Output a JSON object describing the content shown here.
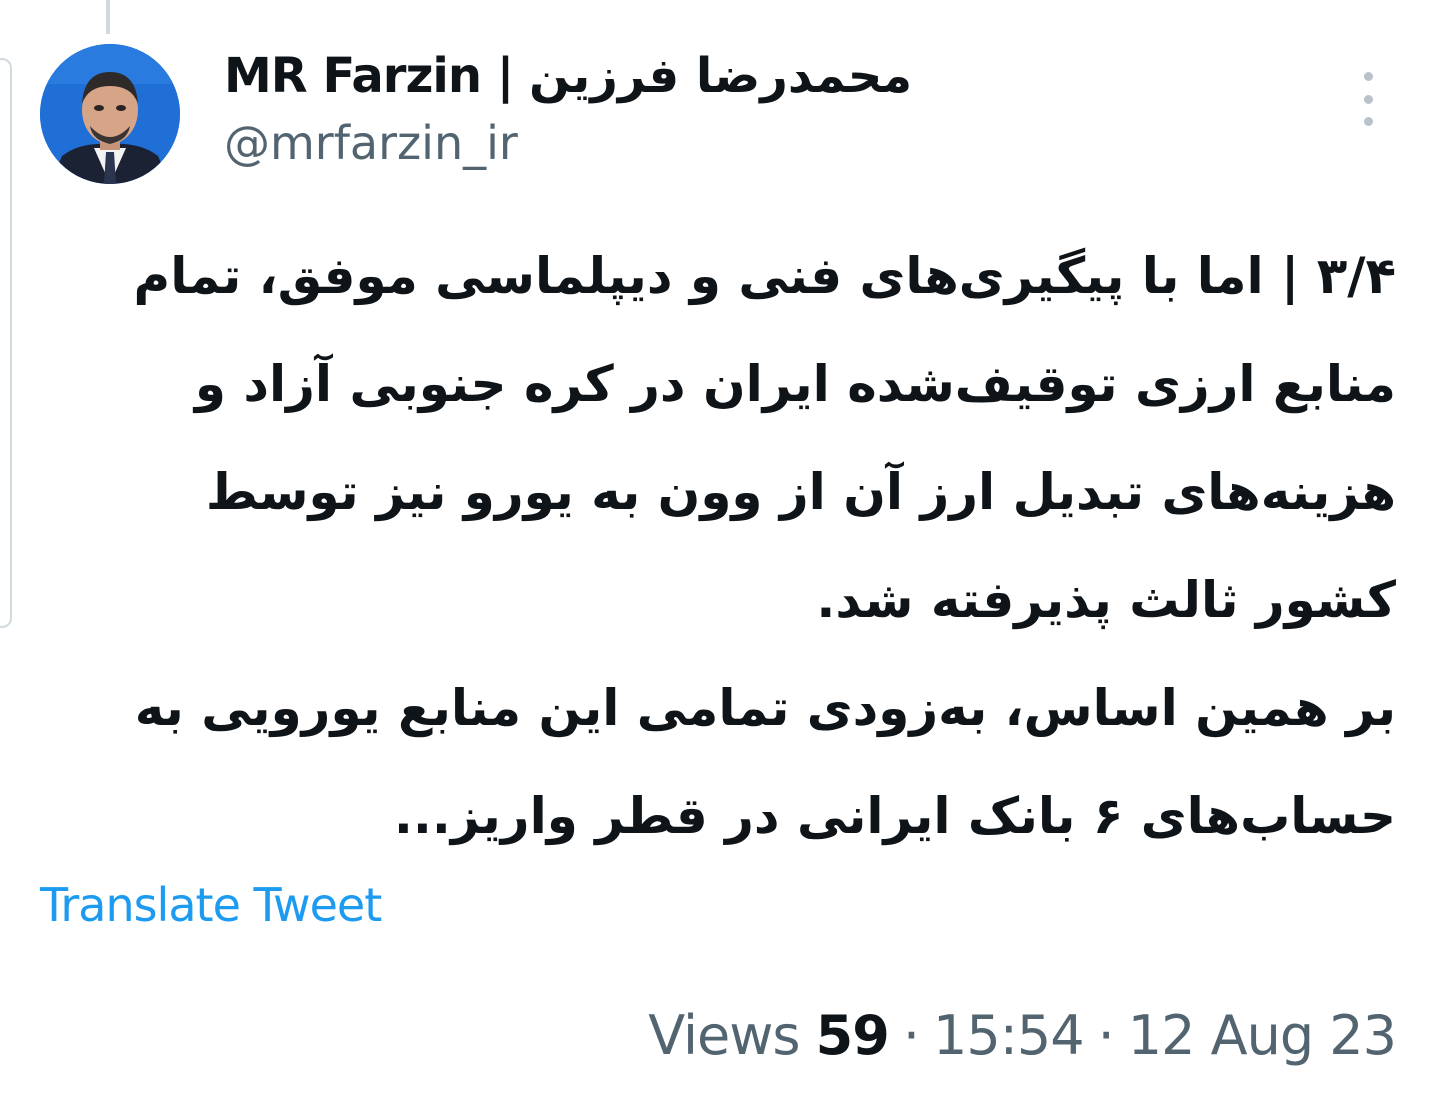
{
  "tweet": {
    "author": {
      "display_name": "MR Farzin | محمدرضا فرزین",
      "handle": "@mrfarzin_ir"
    },
    "body_lines": [
      "۳/۴ | اما با پیگیری‌های فنی و دیپلماسی موفق، تمام",
      "منابع ارزی توقیف‌شده ایران در کره جنوبی آزاد و",
      "هزینه‌های تبدیل ارز آن از وون به یورو نیز توسط",
      "کشور ثالث پذیرفته شد.",
      "بر همین اساس، به‌زودی تمامی این منابع یورویی به",
      "حساب‌های ۶ بانک ایرانی در قطر واریز..."
    ],
    "translate_label": "Translate Tweet",
    "views_label": "Views",
    "views_count": "59",
    "separator": "·",
    "time": "15:54",
    "date": "12 Aug 23"
  },
  "colors": {
    "link": "#1d9bf0",
    "secondary_text": "#536471",
    "primary_text": "#0f1419"
  },
  "icons": {
    "more": "more-vertical-icon",
    "avatar": "profile-photo"
  }
}
